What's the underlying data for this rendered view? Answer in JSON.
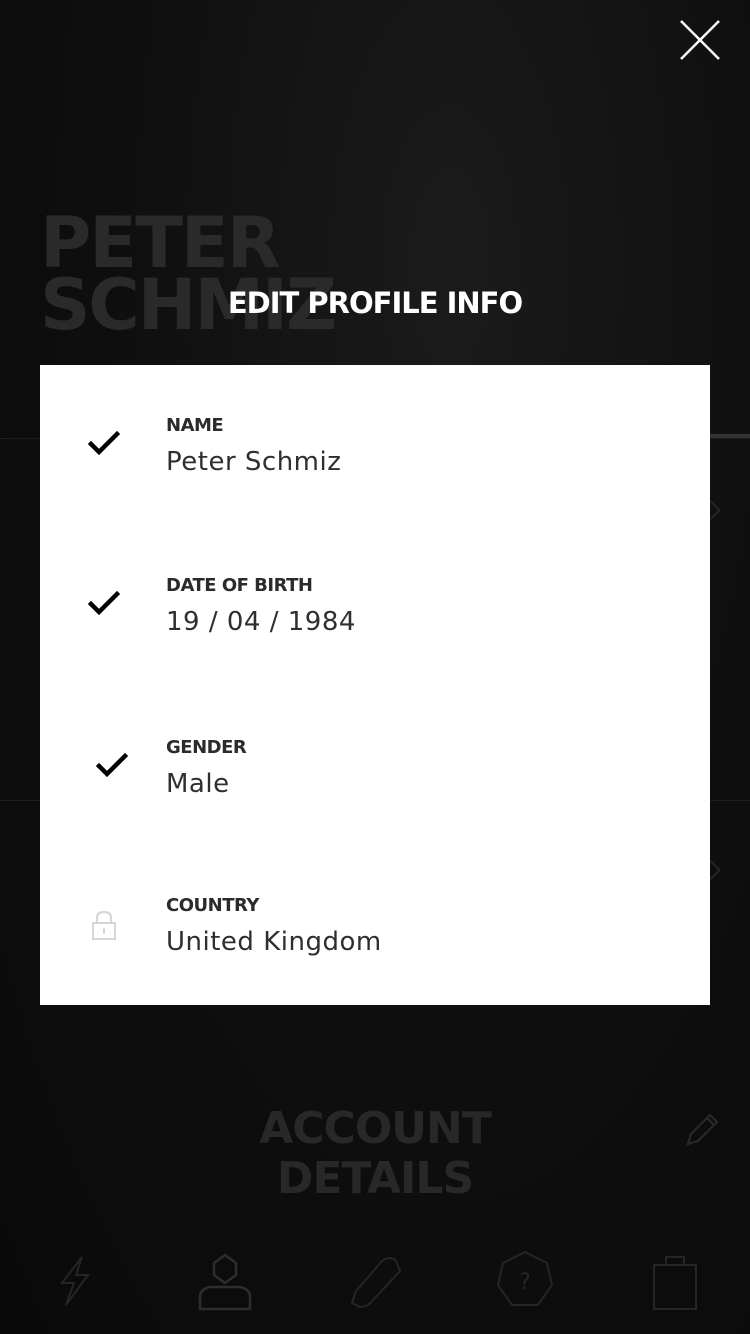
{
  "background": {
    "profile_name": "PETER SCHMIZ",
    "section_title_line1": "ACCOUNT",
    "section_title_line2": "DETAILS",
    "tabs": [
      {
        "icon": "lightning-icon"
      },
      {
        "icon": "user-icon"
      },
      {
        "icon": "shoe-icon"
      },
      {
        "icon": "help-icon"
      },
      {
        "icon": "shopping-bag-icon"
      }
    ]
  },
  "modal": {
    "title": "EDIT PROFILE INFO",
    "close_icon": "close-icon",
    "fields": [
      {
        "label": "NAME",
        "value": "Peter Schmiz",
        "status_icon": "checkmark-icon"
      },
      {
        "label": "DATE OF BIRTH",
        "value": "19 / 04 / 1984",
        "status_icon": "checkmark-icon"
      },
      {
        "label": "GENDER",
        "value": "Male",
        "status_icon": "checkmark-icon"
      },
      {
        "label": "COUNTRY",
        "value": "United Kingdom",
        "status_icon": "lock-icon"
      }
    ]
  },
  "colors": {
    "overlay_bg": "#0d0d0d",
    "card_bg": "#ffffff",
    "text_dark": "#2b2b2b",
    "lock_icon": "#d6d6d6"
  }
}
